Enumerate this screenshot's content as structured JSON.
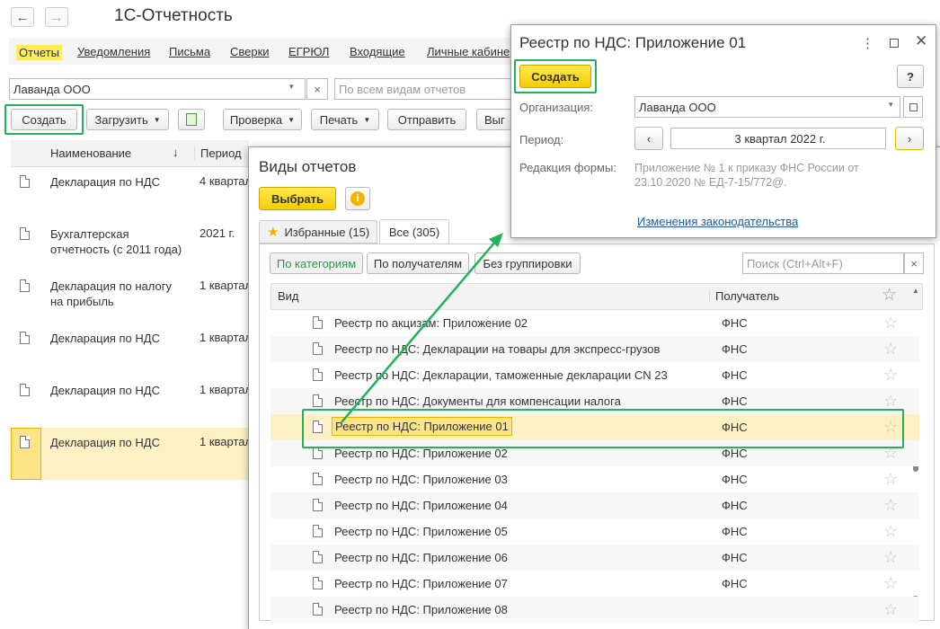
{
  "app": {
    "title": "1С-Отчетность"
  },
  "menu": [
    "Отчеты",
    "Уведомления",
    "Письма",
    "Сверки",
    "ЕГРЮЛ",
    "Входящие",
    "Личные кабине"
  ],
  "filters": {
    "org_value": "Лаванда ООО",
    "clear_symbol": "×",
    "search_placeholder": "По всем видам отчетов"
  },
  "toolbar": {
    "create": "Создать",
    "load": "Загрузить",
    "check": "Проверка",
    "print": "Печать",
    "send": "Отправить",
    "more": "Выг"
  },
  "list": {
    "col_name": "Наименование",
    "sort_arrow": "↓",
    "col_period": "Период",
    "rows": [
      {
        "name": "Декларация по НДС",
        "period": "4 квартал"
      },
      {
        "name": "Бухгалтерская отчетность (с 2011 года)",
        "period": "2021 г."
      },
      {
        "name": "Декларация по налогу на прибыль",
        "period": "1 квартал"
      },
      {
        "name": "Декларация по НДС",
        "period": "1 квартал"
      },
      {
        "name": "Декларация по НДС",
        "period": "1 квартал"
      },
      {
        "name": "Декларация по НДС",
        "period": "1 квартал"
      }
    ]
  },
  "kinds": {
    "title": "Виды отчетов",
    "select": "Выбрать",
    "tabs": [
      "Избранные (15)",
      "Все (305)"
    ],
    "groupings": [
      "По категориям",
      "По получателям",
      "Без группировки"
    ],
    "search_placeholder": "Поиск (Ctrl+Alt+F)",
    "col_kind": "Вид",
    "col_recipient": "Получатель",
    "rows": [
      {
        "name": "Реестр по акцизам: Приложение 02",
        "rec": "ФНС"
      },
      {
        "name": "Реестр по НДС: Декларации на товары для экспресс-грузов",
        "rec": "ФНС"
      },
      {
        "name": "Реестр по НДС: Декларации, таможенные декларации CN 23",
        "rec": "ФНС"
      },
      {
        "name": "Реестр по НДС: Документы для компенсации налога",
        "rec": "ФНС"
      },
      {
        "name": "Реестр по НДС: Приложение 01",
        "rec": "ФНС"
      },
      {
        "name": "Реестр по НДС: Приложение 02",
        "rec": "ФНС"
      },
      {
        "name": "Реестр по НДС: Приложение 03",
        "rec": "ФНС"
      },
      {
        "name": "Реестр по НДС: Приложение 04",
        "rec": "ФНС"
      },
      {
        "name": "Реестр по НДС: Приложение 05",
        "rec": "ФНС"
      },
      {
        "name": "Реестр по НДС: Приложение 06",
        "rec": "ФНС"
      },
      {
        "name": "Реестр по НДС: Приложение 07",
        "rec": "ФНС"
      },
      {
        "name": "Реестр по НДС: Приложение 08",
        "rec": ""
      }
    ]
  },
  "dialog": {
    "title": "Реестр по НДС: Приложение 01",
    "create": "Создать",
    "help": "?",
    "org_label": "Организация:",
    "org_value": "Лаванда ООО",
    "period_label": "Период:",
    "period_value": "3 квартал 2022 г.",
    "edition_label": "Редакция формы:",
    "edition_value": "Приложение № 1 к приказу ФНС России от 23.10.2020 № ЕД-7-15/772@.",
    "link": "Изменения законодательства"
  },
  "colors": {
    "accent_green": "#1fb35a",
    "yellow": "#f3cc07",
    "selected_row": "#fdf1c4"
  }
}
